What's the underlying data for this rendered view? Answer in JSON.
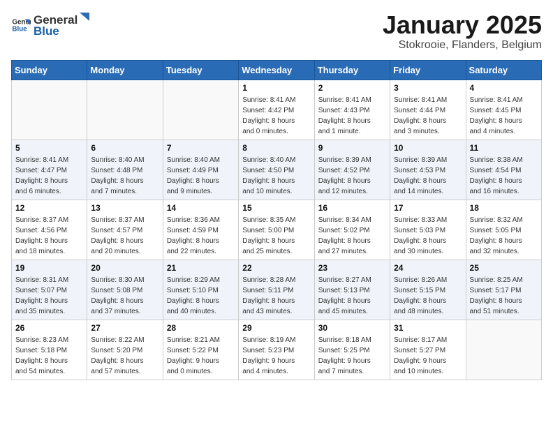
{
  "header": {
    "logo_general": "General",
    "logo_blue": "Blue",
    "month": "January 2025",
    "location": "Stokrooie, Flanders, Belgium"
  },
  "weekdays": [
    "Sunday",
    "Monday",
    "Tuesday",
    "Wednesday",
    "Thursday",
    "Friday",
    "Saturday"
  ],
  "weeks": [
    [
      {
        "day": "",
        "info": ""
      },
      {
        "day": "",
        "info": ""
      },
      {
        "day": "",
        "info": ""
      },
      {
        "day": "1",
        "info": "Sunrise: 8:41 AM\nSunset: 4:42 PM\nDaylight: 8 hours\nand 0 minutes."
      },
      {
        "day": "2",
        "info": "Sunrise: 8:41 AM\nSunset: 4:43 PM\nDaylight: 8 hours\nand 1 minute."
      },
      {
        "day": "3",
        "info": "Sunrise: 8:41 AM\nSunset: 4:44 PM\nDaylight: 8 hours\nand 3 minutes."
      },
      {
        "day": "4",
        "info": "Sunrise: 8:41 AM\nSunset: 4:45 PM\nDaylight: 8 hours\nand 4 minutes."
      }
    ],
    [
      {
        "day": "5",
        "info": "Sunrise: 8:41 AM\nSunset: 4:47 PM\nDaylight: 8 hours\nand 6 minutes."
      },
      {
        "day": "6",
        "info": "Sunrise: 8:40 AM\nSunset: 4:48 PM\nDaylight: 8 hours\nand 7 minutes."
      },
      {
        "day": "7",
        "info": "Sunrise: 8:40 AM\nSunset: 4:49 PM\nDaylight: 8 hours\nand 9 minutes."
      },
      {
        "day": "8",
        "info": "Sunrise: 8:40 AM\nSunset: 4:50 PM\nDaylight: 8 hours\nand 10 minutes."
      },
      {
        "day": "9",
        "info": "Sunrise: 8:39 AM\nSunset: 4:52 PM\nDaylight: 8 hours\nand 12 minutes."
      },
      {
        "day": "10",
        "info": "Sunrise: 8:39 AM\nSunset: 4:53 PM\nDaylight: 8 hours\nand 14 minutes."
      },
      {
        "day": "11",
        "info": "Sunrise: 8:38 AM\nSunset: 4:54 PM\nDaylight: 8 hours\nand 16 minutes."
      }
    ],
    [
      {
        "day": "12",
        "info": "Sunrise: 8:37 AM\nSunset: 4:56 PM\nDaylight: 8 hours\nand 18 minutes."
      },
      {
        "day": "13",
        "info": "Sunrise: 8:37 AM\nSunset: 4:57 PM\nDaylight: 8 hours\nand 20 minutes."
      },
      {
        "day": "14",
        "info": "Sunrise: 8:36 AM\nSunset: 4:59 PM\nDaylight: 8 hours\nand 22 minutes."
      },
      {
        "day": "15",
        "info": "Sunrise: 8:35 AM\nSunset: 5:00 PM\nDaylight: 8 hours\nand 25 minutes."
      },
      {
        "day": "16",
        "info": "Sunrise: 8:34 AM\nSunset: 5:02 PM\nDaylight: 8 hours\nand 27 minutes."
      },
      {
        "day": "17",
        "info": "Sunrise: 8:33 AM\nSunset: 5:03 PM\nDaylight: 8 hours\nand 30 minutes."
      },
      {
        "day": "18",
        "info": "Sunrise: 8:32 AM\nSunset: 5:05 PM\nDaylight: 8 hours\nand 32 minutes."
      }
    ],
    [
      {
        "day": "19",
        "info": "Sunrise: 8:31 AM\nSunset: 5:07 PM\nDaylight: 8 hours\nand 35 minutes."
      },
      {
        "day": "20",
        "info": "Sunrise: 8:30 AM\nSunset: 5:08 PM\nDaylight: 8 hours\nand 37 minutes."
      },
      {
        "day": "21",
        "info": "Sunrise: 8:29 AM\nSunset: 5:10 PM\nDaylight: 8 hours\nand 40 minutes."
      },
      {
        "day": "22",
        "info": "Sunrise: 8:28 AM\nSunset: 5:11 PM\nDaylight: 8 hours\nand 43 minutes."
      },
      {
        "day": "23",
        "info": "Sunrise: 8:27 AM\nSunset: 5:13 PM\nDaylight: 8 hours\nand 45 minutes."
      },
      {
        "day": "24",
        "info": "Sunrise: 8:26 AM\nSunset: 5:15 PM\nDaylight: 8 hours\nand 48 minutes."
      },
      {
        "day": "25",
        "info": "Sunrise: 8:25 AM\nSunset: 5:17 PM\nDaylight: 8 hours\nand 51 minutes."
      }
    ],
    [
      {
        "day": "26",
        "info": "Sunrise: 8:23 AM\nSunset: 5:18 PM\nDaylight: 8 hours\nand 54 minutes."
      },
      {
        "day": "27",
        "info": "Sunrise: 8:22 AM\nSunset: 5:20 PM\nDaylight: 8 hours\nand 57 minutes."
      },
      {
        "day": "28",
        "info": "Sunrise: 8:21 AM\nSunset: 5:22 PM\nDaylight: 9 hours\nand 0 minutes."
      },
      {
        "day": "29",
        "info": "Sunrise: 8:19 AM\nSunset: 5:23 PM\nDaylight: 9 hours\nand 4 minutes."
      },
      {
        "day": "30",
        "info": "Sunrise: 8:18 AM\nSunset: 5:25 PM\nDaylight: 9 hours\nand 7 minutes."
      },
      {
        "day": "31",
        "info": "Sunrise: 8:17 AM\nSunset: 5:27 PM\nDaylight: 9 hours\nand 10 minutes."
      },
      {
        "day": "",
        "info": ""
      }
    ]
  ]
}
